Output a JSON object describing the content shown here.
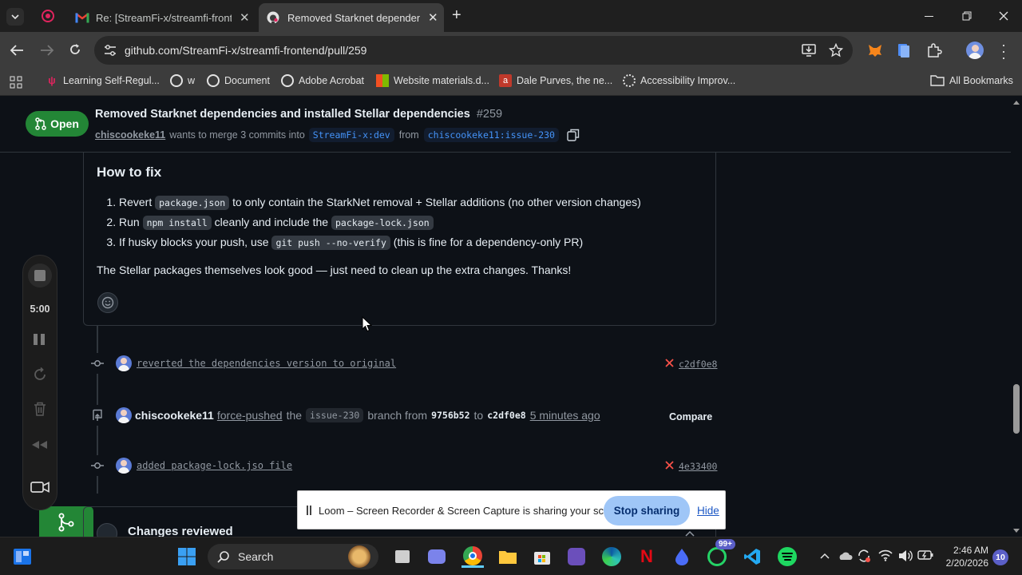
{
  "browser": {
    "tabs": [
      {
        "title": "Re: [StreamFi-x/streamfi-fronten",
        "active": false
      },
      {
        "title": "Removed Starknet dependencie",
        "active": true
      }
    ],
    "new_tab": "+",
    "url": "github.com/StreamFi-x/streamfi-frontend/pull/259",
    "bookmarks": [
      "Learning Self-Regul...",
      "w",
      "Document",
      "Adobe Acrobat",
      "Website materials.d...",
      "Dale Purves, the ne...",
      "Accessibility Improv..."
    ],
    "all_bookmarks": "All Bookmarks"
  },
  "pr": {
    "state": "Open",
    "title": "Removed Starknet dependencies and installed Stellar dependencies",
    "number": "#259",
    "author": "chiscookeke11",
    "merge_text": "wants to merge 3 commits into",
    "base_branch": "StreamFi-x:dev",
    "from_text": "from",
    "head_branch": "chiscookeke11:issue-230"
  },
  "comment": {
    "heading": "How to fix",
    "steps": [
      {
        "pre": "Revert ",
        "code": "package.json",
        "post": " to only contain the StarkNet removal + Stellar additions (no other version changes)"
      },
      {
        "pre": "Run ",
        "code": "npm install",
        "post": " cleanly and include the ",
        "code2": "package-lock.json"
      },
      {
        "pre": "If husky blocks your push, use ",
        "code": "git push --no-verify",
        "post": " (this is fine for a dependency-only PR)"
      }
    ],
    "closing": "The Stellar packages themselves look good — just need to clean up the extra changes. Thanks!"
  },
  "timeline": {
    "commit1": {
      "message": "reverted the dependencies version to original",
      "sha": "c2df0e8"
    },
    "force_push": {
      "author": "chiscookeke11",
      "action": "force-pushed",
      "the": "the",
      "branch": "issue-230",
      "branch_from": "branch from",
      "from_sha": "9756b52",
      "to": "to",
      "to_sha": "c2df0e8",
      "time": "5 minutes ago",
      "compare": "Compare"
    },
    "commit2": {
      "message": "added package-lock.jso file",
      "sha": "4e33400"
    },
    "changes_reviewed": "Changes reviewed"
  },
  "loom": {
    "timer": "5:00",
    "share_message": "Loom – Screen Recorder & Screen Capture is sharing your screen.",
    "stop_sharing": "Stop sharing",
    "hide": "Hide"
  },
  "taskbar": {
    "search": "Search",
    "whatsapp_badge": "99+",
    "time": "2:46 AM",
    "date": "2/20/2026",
    "notifications": "10"
  },
  "colors": {
    "accent_green": "#238636",
    "link_blue": "#4493f8",
    "loom_button": "#9fc6f7"
  }
}
